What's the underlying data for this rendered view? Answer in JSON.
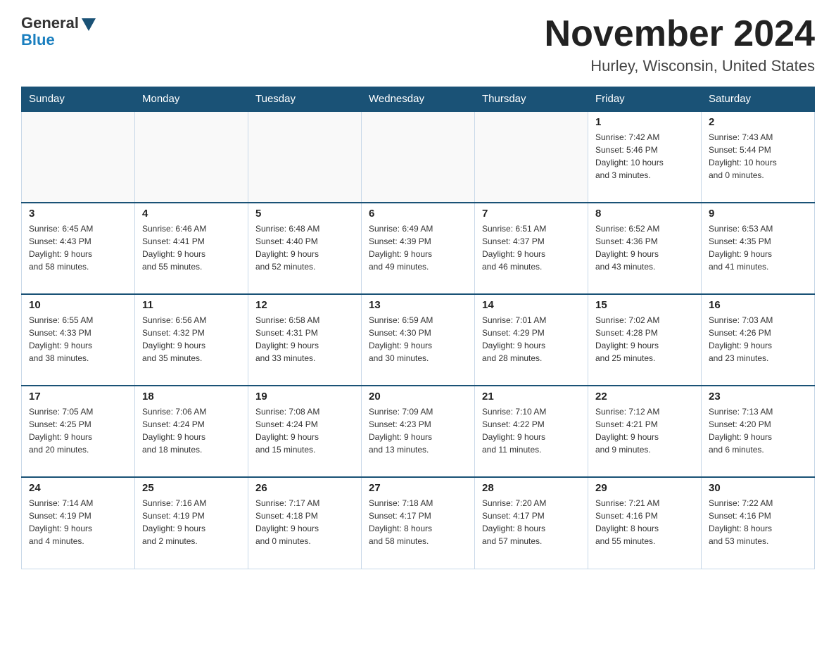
{
  "header": {
    "logo_general": "General",
    "logo_blue": "Blue",
    "month_title": "November 2024",
    "location": "Hurley, Wisconsin, United States"
  },
  "days_of_week": [
    "Sunday",
    "Monday",
    "Tuesday",
    "Wednesday",
    "Thursday",
    "Friday",
    "Saturday"
  ],
  "weeks": [
    [
      {
        "day": "",
        "info": ""
      },
      {
        "day": "",
        "info": ""
      },
      {
        "day": "",
        "info": ""
      },
      {
        "day": "",
        "info": ""
      },
      {
        "day": "",
        "info": ""
      },
      {
        "day": "1",
        "info": "Sunrise: 7:42 AM\nSunset: 5:46 PM\nDaylight: 10 hours\nand 3 minutes."
      },
      {
        "day": "2",
        "info": "Sunrise: 7:43 AM\nSunset: 5:44 PM\nDaylight: 10 hours\nand 0 minutes."
      }
    ],
    [
      {
        "day": "3",
        "info": "Sunrise: 6:45 AM\nSunset: 4:43 PM\nDaylight: 9 hours\nand 58 minutes."
      },
      {
        "day": "4",
        "info": "Sunrise: 6:46 AM\nSunset: 4:41 PM\nDaylight: 9 hours\nand 55 minutes."
      },
      {
        "day": "5",
        "info": "Sunrise: 6:48 AM\nSunset: 4:40 PM\nDaylight: 9 hours\nand 52 minutes."
      },
      {
        "day": "6",
        "info": "Sunrise: 6:49 AM\nSunset: 4:39 PM\nDaylight: 9 hours\nand 49 minutes."
      },
      {
        "day": "7",
        "info": "Sunrise: 6:51 AM\nSunset: 4:37 PM\nDaylight: 9 hours\nand 46 minutes."
      },
      {
        "day": "8",
        "info": "Sunrise: 6:52 AM\nSunset: 4:36 PM\nDaylight: 9 hours\nand 43 minutes."
      },
      {
        "day": "9",
        "info": "Sunrise: 6:53 AM\nSunset: 4:35 PM\nDaylight: 9 hours\nand 41 minutes."
      }
    ],
    [
      {
        "day": "10",
        "info": "Sunrise: 6:55 AM\nSunset: 4:33 PM\nDaylight: 9 hours\nand 38 minutes."
      },
      {
        "day": "11",
        "info": "Sunrise: 6:56 AM\nSunset: 4:32 PM\nDaylight: 9 hours\nand 35 minutes."
      },
      {
        "day": "12",
        "info": "Sunrise: 6:58 AM\nSunset: 4:31 PM\nDaylight: 9 hours\nand 33 minutes."
      },
      {
        "day": "13",
        "info": "Sunrise: 6:59 AM\nSunset: 4:30 PM\nDaylight: 9 hours\nand 30 minutes."
      },
      {
        "day": "14",
        "info": "Sunrise: 7:01 AM\nSunset: 4:29 PM\nDaylight: 9 hours\nand 28 minutes."
      },
      {
        "day": "15",
        "info": "Sunrise: 7:02 AM\nSunset: 4:28 PM\nDaylight: 9 hours\nand 25 minutes."
      },
      {
        "day": "16",
        "info": "Sunrise: 7:03 AM\nSunset: 4:26 PM\nDaylight: 9 hours\nand 23 minutes."
      }
    ],
    [
      {
        "day": "17",
        "info": "Sunrise: 7:05 AM\nSunset: 4:25 PM\nDaylight: 9 hours\nand 20 minutes."
      },
      {
        "day": "18",
        "info": "Sunrise: 7:06 AM\nSunset: 4:24 PM\nDaylight: 9 hours\nand 18 minutes."
      },
      {
        "day": "19",
        "info": "Sunrise: 7:08 AM\nSunset: 4:24 PM\nDaylight: 9 hours\nand 15 minutes."
      },
      {
        "day": "20",
        "info": "Sunrise: 7:09 AM\nSunset: 4:23 PM\nDaylight: 9 hours\nand 13 minutes."
      },
      {
        "day": "21",
        "info": "Sunrise: 7:10 AM\nSunset: 4:22 PM\nDaylight: 9 hours\nand 11 minutes."
      },
      {
        "day": "22",
        "info": "Sunrise: 7:12 AM\nSunset: 4:21 PM\nDaylight: 9 hours\nand 9 minutes."
      },
      {
        "day": "23",
        "info": "Sunrise: 7:13 AM\nSunset: 4:20 PM\nDaylight: 9 hours\nand 6 minutes."
      }
    ],
    [
      {
        "day": "24",
        "info": "Sunrise: 7:14 AM\nSunset: 4:19 PM\nDaylight: 9 hours\nand 4 minutes."
      },
      {
        "day": "25",
        "info": "Sunrise: 7:16 AM\nSunset: 4:19 PM\nDaylight: 9 hours\nand 2 minutes."
      },
      {
        "day": "26",
        "info": "Sunrise: 7:17 AM\nSunset: 4:18 PM\nDaylight: 9 hours\nand 0 minutes."
      },
      {
        "day": "27",
        "info": "Sunrise: 7:18 AM\nSunset: 4:17 PM\nDaylight: 8 hours\nand 58 minutes."
      },
      {
        "day": "28",
        "info": "Sunrise: 7:20 AM\nSunset: 4:17 PM\nDaylight: 8 hours\nand 57 minutes."
      },
      {
        "day": "29",
        "info": "Sunrise: 7:21 AM\nSunset: 4:16 PM\nDaylight: 8 hours\nand 55 minutes."
      },
      {
        "day": "30",
        "info": "Sunrise: 7:22 AM\nSunset: 4:16 PM\nDaylight: 8 hours\nand 53 minutes."
      }
    ]
  ]
}
